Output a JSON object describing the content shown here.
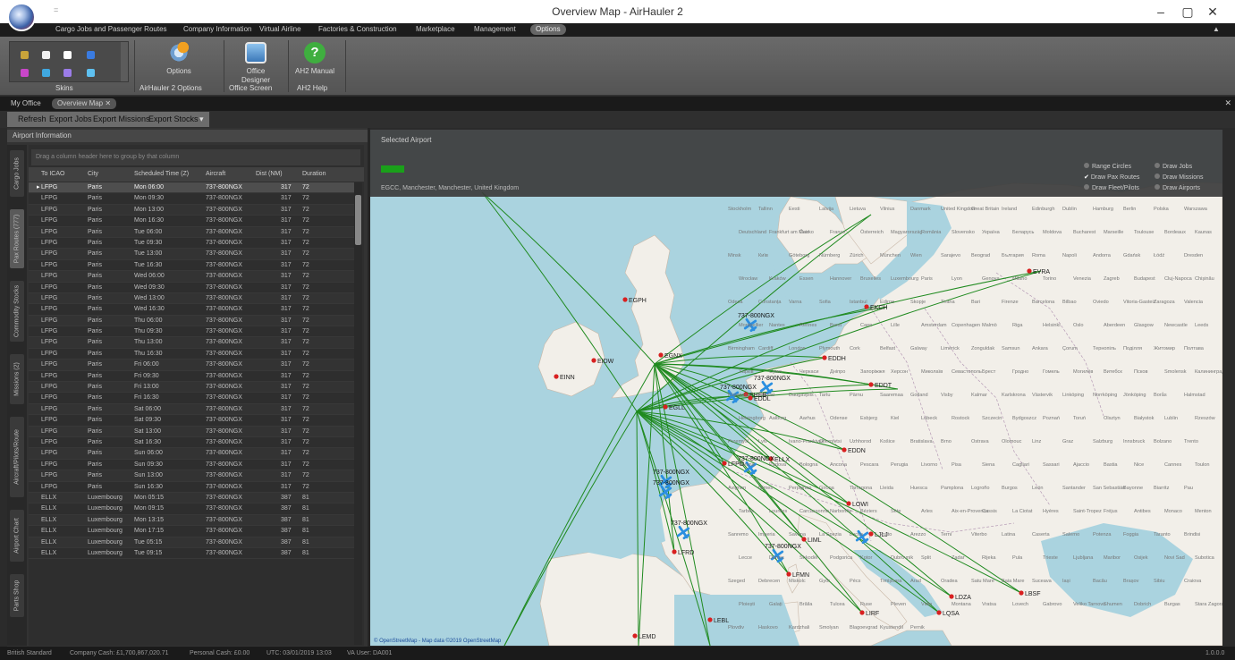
{
  "window": {
    "title": "Overview Map - AirHauler 2",
    "quick_access": "="
  },
  "menu": {
    "items": [
      "Cargo Jobs and Passenger Routes",
      "Company Information",
      "Virtual Airline",
      "Factories & Construction",
      "Marketplace",
      "Management",
      "Options"
    ],
    "active": "Options",
    "collapse_glyph": "▲"
  },
  "ribbon": {
    "groups": [
      {
        "label": "Skins"
      },
      {
        "label": "AirHauler 2 Options",
        "buttons": [
          "Options"
        ]
      },
      {
        "label": "Office Screen",
        "buttons": [
          "Office Designer"
        ]
      },
      {
        "label": "AH2 Help",
        "buttons": [
          "AH2 Manual"
        ]
      }
    ],
    "skin_colors": [
      "#c9a33a",
      "#f0f0f0",
      "#ffffff",
      "#3a7be0",
      "#c846c8",
      "#40a8e0",
      "#9b7ce8",
      "#5ec0f0"
    ]
  },
  "doc_tabs": [
    "My Office",
    "Overview Map"
  ],
  "toolbar": {
    "buttons": [
      "Refresh",
      "Export Jobs",
      "Export Missions",
      "Export Stocks"
    ]
  },
  "left_panel": {
    "title": "Airport Information",
    "side_tabs": [
      "Cargo Jobs",
      "Pax Routes (777)",
      "Commodity Stocks",
      "Missions (2)",
      "Aircraft/Pilots/Route",
      "Airport Chart",
      "Parts Shop"
    ],
    "active_side_tab": "Pax Routes (777)",
    "group_hint": "Drag a column header here to group by that column",
    "columns": [
      "To ICAO",
      "City",
      "Scheduled Time (Z)",
      "Aircraft",
      "Dist (NM)",
      "Duration"
    ],
    "rows": [
      [
        "LFPG",
        "Paris",
        "Mon 06:00",
        "737-800NGX",
        "317",
        "72"
      ],
      [
        "LFPG",
        "Paris",
        "Mon 09:30",
        "737-800NGX",
        "317",
        "72"
      ],
      [
        "LFPG",
        "Paris",
        "Mon 13:00",
        "737-800NGX",
        "317",
        "72"
      ],
      [
        "LFPG",
        "Paris",
        "Mon 16:30",
        "737-800NGX",
        "317",
        "72"
      ],
      [
        "LFPG",
        "Paris",
        "Tue 06:00",
        "737-800NGX",
        "317",
        "72"
      ],
      [
        "LFPG",
        "Paris",
        "Tue 09:30",
        "737-800NGX",
        "317",
        "72"
      ],
      [
        "LFPG",
        "Paris",
        "Tue 13:00",
        "737-800NGX",
        "317",
        "72"
      ],
      [
        "LFPG",
        "Paris",
        "Tue 16:30",
        "737-800NGX",
        "317",
        "72"
      ],
      [
        "LFPG",
        "Paris",
        "Wed 06:00",
        "737-800NGX",
        "317",
        "72"
      ],
      [
        "LFPG",
        "Paris",
        "Wed 09:30",
        "737-800NGX",
        "317",
        "72"
      ],
      [
        "LFPG",
        "Paris",
        "Wed 13:00",
        "737-800NGX",
        "317",
        "72"
      ],
      [
        "LFPG",
        "Paris",
        "Wed 16:30",
        "737-800NGX",
        "317",
        "72"
      ],
      [
        "LFPG",
        "Paris",
        "Thu 06:00",
        "737-800NGX",
        "317",
        "72"
      ],
      [
        "LFPG",
        "Paris",
        "Thu 09:30",
        "737-800NGX",
        "317",
        "72"
      ],
      [
        "LFPG",
        "Paris",
        "Thu 13:00",
        "737-800NGX",
        "317",
        "72"
      ],
      [
        "LFPG",
        "Paris",
        "Thu 16:30",
        "737-800NGX",
        "317",
        "72"
      ],
      [
        "LFPG",
        "Paris",
        "Fri 06:00",
        "737-800NGX",
        "317",
        "72"
      ],
      [
        "LFPG",
        "Paris",
        "Fri 09:30",
        "737-800NGX",
        "317",
        "72"
      ],
      [
        "LFPG",
        "Paris",
        "Fri 13:00",
        "737-800NGX",
        "317",
        "72"
      ],
      [
        "LFPG",
        "Paris",
        "Fri 16:30",
        "737-800NGX",
        "317",
        "72"
      ],
      [
        "LFPG",
        "Paris",
        "Sat 06:00",
        "737-800NGX",
        "317",
        "72"
      ],
      [
        "LFPG",
        "Paris",
        "Sat 09:30",
        "737-800NGX",
        "317",
        "72"
      ],
      [
        "LFPG",
        "Paris",
        "Sat 13:00",
        "737-800NGX",
        "317",
        "72"
      ],
      [
        "LFPG",
        "Paris",
        "Sat 16:30",
        "737-800NGX",
        "317",
        "72"
      ],
      [
        "LFPG",
        "Paris",
        "Sun 06:00",
        "737-800NGX",
        "317",
        "72"
      ],
      [
        "LFPG",
        "Paris",
        "Sun 09:30",
        "737-800NGX",
        "317",
        "72"
      ],
      [
        "LFPG",
        "Paris",
        "Sun 13:00",
        "737-800NGX",
        "317",
        "72"
      ],
      [
        "LFPG",
        "Paris",
        "Sun 16:30",
        "737-800NGX",
        "317",
        "72"
      ],
      [
        "ELLX",
        "Luxembourg",
        "Mon 05:15",
        "737-800NGX",
        "387",
        "81"
      ],
      [
        "ELLX",
        "Luxembourg",
        "Mon 09:15",
        "737-800NGX",
        "387",
        "81"
      ],
      [
        "ELLX",
        "Luxembourg",
        "Mon 13:15",
        "737-800NGX",
        "387",
        "81"
      ],
      [
        "ELLX",
        "Luxembourg",
        "Mon 17:15",
        "737-800NGX",
        "387",
        "81"
      ],
      [
        "ELLX",
        "Luxembourg",
        "Tue 05:15",
        "737-800NGX",
        "387",
        "81"
      ],
      [
        "ELLX",
        "Luxembourg",
        "Tue 09:15",
        "737-800NGX",
        "387",
        "81"
      ]
    ]
  },
  "map": {
    "header": "Selected Airport",
    "airport_desc": "EGCC, Manchester, Manchester, United Kingdom",
    "options": [
      "Range Circles",
      "Draw Pax Routes",
      "Draw Fleet/Pilots",
      "Draw Jobs",
      "Draw Missions",
      "Draw Airports"
    ],
    "checked_option": "Draw Pax Routes",
    "attribution": "© OpenStreetMap - Map data ©2019 OpenStreetMap",
    "route_color": "#1f8a1f",
    "plane_color": "#2b8fe0",
    "airport_color": "#d82020",
    "airports": [
      {
        "code": "EGPH"
      },
      {
        "code": "EGNX"
      },
      {
        "code": "EIDW"
      },
      {
        "code": "EINN"
      },
      {
        "code": "EGLL"
      },
      {
        "code": "EHEB"
      },
      {
        "code": "EDDH"
      },
      {
        "code": "EKCH"
      },
      {
        "code": "EVRA"
      },
      {
        "code": "EDDT"
      },
      {
        "code": "EDDL"
      },
      {
        "code": "ELLX"
      },
      {
        "code": "LFPO"
      },
      {
        "code": "EDDN"
      },
      {
        "code": "LOWI"
      },
      {
        "code": "LFRD"
      },
      {
        "code": "LIML"
      },
      {
        "code": "LFMN"
      },
      {
        "code": "LIRF"
      },
      {
        "code": "LDZA"
      },
      {
        "code": "LBSF"
      },
      {
        "code": "LQSA"
      },
      {
        "code": "LEBL"
      },
      {
        "code": "LEMD"
      },
      {
        "code": "LJLJ"
      }
    ],
    "aircraft_labels": [
      "737-800NGX",
      "737-800NGX",
      "737-800NGX",
      "737-800NGX",
      "737-800NGX",
      "737-800NGX",
      "737-800NGX",
      "737-800NGX"
    ],
    "place_names": [
      "Stockholm",
      "Tallinn",
      "Eesti",
      "Latvija",
      "Lietuva",
      "Vilnius",
      "Danmark",
      "United Kingdom",
      "Great Britain",
      "Ireland",
      "Edinburgh",
      "Dublin",
      "Hamburg",
      "Berlin",
      "Polska",
      "Warszawa",
      "Deutschland",
      "Frankfurt am Main",
      "Česko",
      "France",
      "Österreich",
      "Magyarország",
      "România",
      "Slovensko",
      "Україна",
      "Беларусь",
      "Moldova",
      "Bucharest",
      "Marseille",
      "Toulouse",
      "Bordeaux",
      "Kaunas",
      "Minsk",
      "Київ",
      "Göteborg",
      "Nürnberg",
      "Zürich",
      "München",
      "Wien",
      "Sarajevo",
      "Beograd",
      "България",
      "Roma",
      "Napoli",
      "Andorra",
      "Gdańsk",
      "Łódź",
      "Dresden",
      "Wrocław",
      "Kraków",
      "Essen",
      "Hannover",
      "Bruxelles",
      "Luxembourg",
      "Paris",
      "Lyon",
      "Genova",
      "Milano",
      "Torino",
      "Venezia",
      "Zagreb",
      "Budapest",
      "Cluj-Napoca",
      "Chișinău",
      "Odesa",
      "Constanța",
      "Varna",
      "Sofia",
      "Istanbul",
      "Edirne",
      "Skopje",
      "Tirana",
      "Bari",
      "Firenze",
      "Barcelona",
      "Bilbao",
      "Oviedo",
      "Vitoria-Gasteiz",
      "Zaragoza",
      "Valencia",
      "Montpellier",
      "Nantes",
      "Rennes",
      "Brest",
      "Caen",
      "Lille",
      "Amsterdam",
      "Copenhagen",
      "Malmö",
      "Riga",
      "Helsinki",
      "Oslo",
      "Aberdeen",
      "Glasgow",
      "Newcastle",
      "Leeds",
      "Birmingham",
      "Cardiff",
      "London",
      "Plymouth",
      "Cork",
      "Belfast",
      "Galway",
      "Limerick",
      "Zonguldak",
      "Samsun",
      "Ankara",
      "Çorum",
      "Тернопіль",
      "Поділля",
      "Житомир",
      "Полтава",
      "Харків",
      "Суми",
      "Черкаси",
      "Дніпро",
      "Запоріжжя",
      "Херсон",
      "Миколаїв",
      "Севастополь",
      "Брест",
      "Гродно",
      "Гомель",
      "Могилёв",
      "Витебск",
      "Псков",
      "Smolensk",
      "Калининград",
      "Klaipėda",
      "Šiauliai",
      "Daugavpils",
      "Tartu",
      "Pärnu",
      "Saaremaa",
      "Gotland",
      "Visby",
      "Kalmar",
      "Karlskrona",
      "Västervik",
      "Linköping",
      "Norrköping",
      "Jönköping",
      "Borås",
      "Halmstad",
      "Helsingborg",
      "Aalborg",
      "Aarhus",
      "Odense",
      "Esbjerg",
      "Kiel",
      "Lübeck",
      "Rostock",
      "Szczecin",
      "Bydgoszcz",
      "Poznań",
      "Toruń",
      "Olsztyn",
      "Białystok",
      "Lublin",
      "Rzeszów",
      "Przemyśl",
      "Lviv",
      "Ivano-Frankivsk",
      "Chernivtsi",
      "Uzhhorod",
      "Košice",
      "Bratislava",
      "Brno",
      "Ostrava",
      "Olomouc",
      "Linz",
      "Graz",
      "Salzburg",
      "Innsbruck",
      "Bolzano",
      "Trento",
      "Verona",
      "Padova",
      "Bologna",
      "Ancona",
      "Pescara",
      "Perugia",
      "Livorno",
      "Pisa",
      "Siena",
      "Cagliari",
      "Sassari",
      "Ajaccio",
      "Bastia",
      "Nice",
      "Cannes",
      "Toulon",
      "Avignon",
      "Nîmes",
      "Perpignan",
      "Girona",
      "Tarragona",
      "Lleida",
      "Huesca",
      "Pamplona",
      "Logroño",
      "Burgos",
      "León",
      "Santander",
      "San Sebastián",
      "Bayonne",
      "Biarritz",
      "Pau",
      "Tarbes",
      "Lourdes",
      "Carcassonne",
      "Narbonne",
      "Béziers",
      "Sète",
      "Arles",
      "Aix-en-Provence",
      "Cassis",
      "La Ciotat",
      "Hyères",
      "Saint-Tropez",
      "Fréjus",
      "Antibes",
      "Monaco",
      "Menton",
      "Sanremo",
      "Imperia",
      "Savona",
      "La Spezia",
      "Lucca",
      "Prato",
      "Arezzo",
      "Terni",
      "Viterbo",
      "Latina",
      "Caserta",
      "Salerno",
      "Potenza",
      "Foggia",
      "Taranto",
      "Brindisi",
      "Lecce",
      "Durrës",
      "Shkodër",
      "Podgorica",
      "Kotor",
      "Dubrovnik",
      "Split",
      "Zadar",
      "Rijeka",
      "Pula",
      "Trieste",
      "Ljubljana",
      "Maribor",
      "Osijek",
      "Novi Sad",
      "Subotica",
      "Szeged",
      "Debrecen",
      "Miskolc",
      "Győr",
      "Pécs",
      "Timișoara",
      "Arad",
      "Oradea",
      "Satu Mare",
      "Baia Mare",
      "Suceava",
      "Iași",
      "Bacău",
      "Brașov",
      "Sibiu",
      "Craiova",
      "Ploiești",
      "Galați",
      "Brăila",
      "Tulcea",
      "Ruse",
      "Pleven",
      "Vidin",
      "Montana",
      "Vratsa",
      "Lovech",
      "Gabrovo",
      "Veliko Tarnovo",
      "Shumen",
      "Dobrich",
      "Burgas",
      "Stara Zagora",
      "Plovdiv",
      "Haskovo",
      "Kardzhali",
      "Smolyan",
      "Blagoevgrad",
      "Kyustendil",
      "Pernik"
    ]
  },
  "status": {
    "skin": "British Standard",
    "company_cash": "Company Cash: £1,700,867,020.71",
    "personal_cash": "Personal Cash: £0.00",
    "utc": "UTC: 03/01/2019 13:03",
    "va_user": "VA User: DA001",
    "version": "1.0.0.0"
  }
}
